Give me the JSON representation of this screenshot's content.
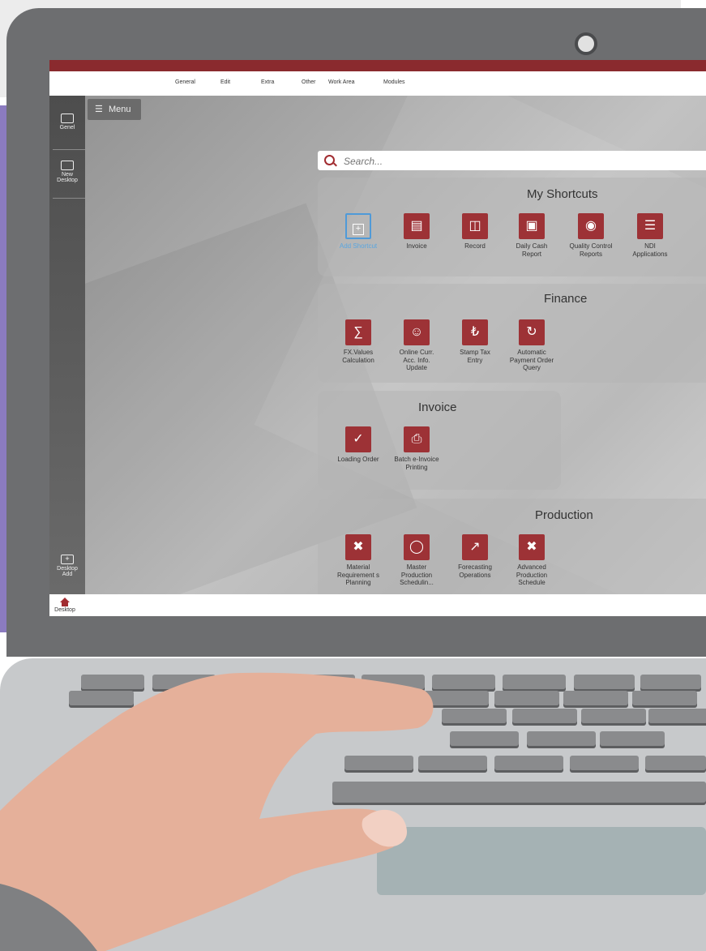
{
  "menubar": {
    "items": [
      "General",
      "Edit",
      "Extra",
      "Other",
      "Work Area",
      "Modules"
    ]
  },
  "sidebar": {
    "items": [
      {
        "label_line1": "Genel",
        "label_line2": ""
      },
      {
        "label_line1": "New",
        "label_line2": "Desktop"
      }
    ],
    "desktop_add": {
      "line1": "Desktop",
      "line2": "Add"
    }
  },
  "menu_button": {
    "label": "Menu"
  },
  "search": {
    "placeholder": "Search..."
  },
  "panels": {
    "shortcuts": {
      "title": "My Shortcuts",
      "tiles": [
        {
          "label": "Add Shortcut",
          "icon": "plus-icon"
        },
        {
          "label": "Invoice",
          "icon": "invoice-icon"
        },
        {
          "label": "Record",
          "icon": "record-icon"
        },
        {
          "label": "Daily Cash Report",
          "icon": "safe-icon"
        },
        {
          "label": "Quality Control Reports",
          "icon": "certificate-icon"
        },
        {
          "label": "NDI Applications",
          "icon": "list-icon"
        }
      ]
    },
    "finance": {
      "title": "Finance",
      "tiles": [
        {
          "label": "FX.Values Calculation",
          "icon": "calculator-icon"
        },
        {
          "label": "Online Curr. Acc. Info. Update",
          "icon": "user-sync-icon"
        },
        {
          "label": "Stamp Tax Entry",
          "icon": "house-lira-icon"
        },
        {
          "label": "Automatic Payment Order Query",
          "icon": "lira-refresh-icon"
        }
      ]
    },
    "invoice": {
      "title": "Invoice",
      "tiles": [
        {
          "label": "Loading Order",
          "icon": "hand-truck-icon"
        },
        {
          "label": "Batch e-Invoice Printing",
          "icon": "printer-icon"
        }
      ]
    },
    "production": {
      "title": "Production",
      "tiles": [
        {
          "label": "Material Requirement s Planning",
          "icon": "tools-icon"
        },
        {
          "label": "Master Production Schedulin...",
          "icon": "chart-cycle-icon"
        },
        {
          "label": "Forecasting Operations",
          "icon": "line-chart-icon"
        },
        {
          "label": "Advanced Production Schedule",
          "icon": "tools-calc-icon"
        }
      ]
    }
  },
  "taskbar": {
    "home_label": "Desktop"
  },
  "colors": {
    "accent": "#9d3236",
    "top_bar": "#8a2a2e",
    "add_shortcut": "#4f9ad8",
    "side_band": "#8b7bbf"
  }
}
